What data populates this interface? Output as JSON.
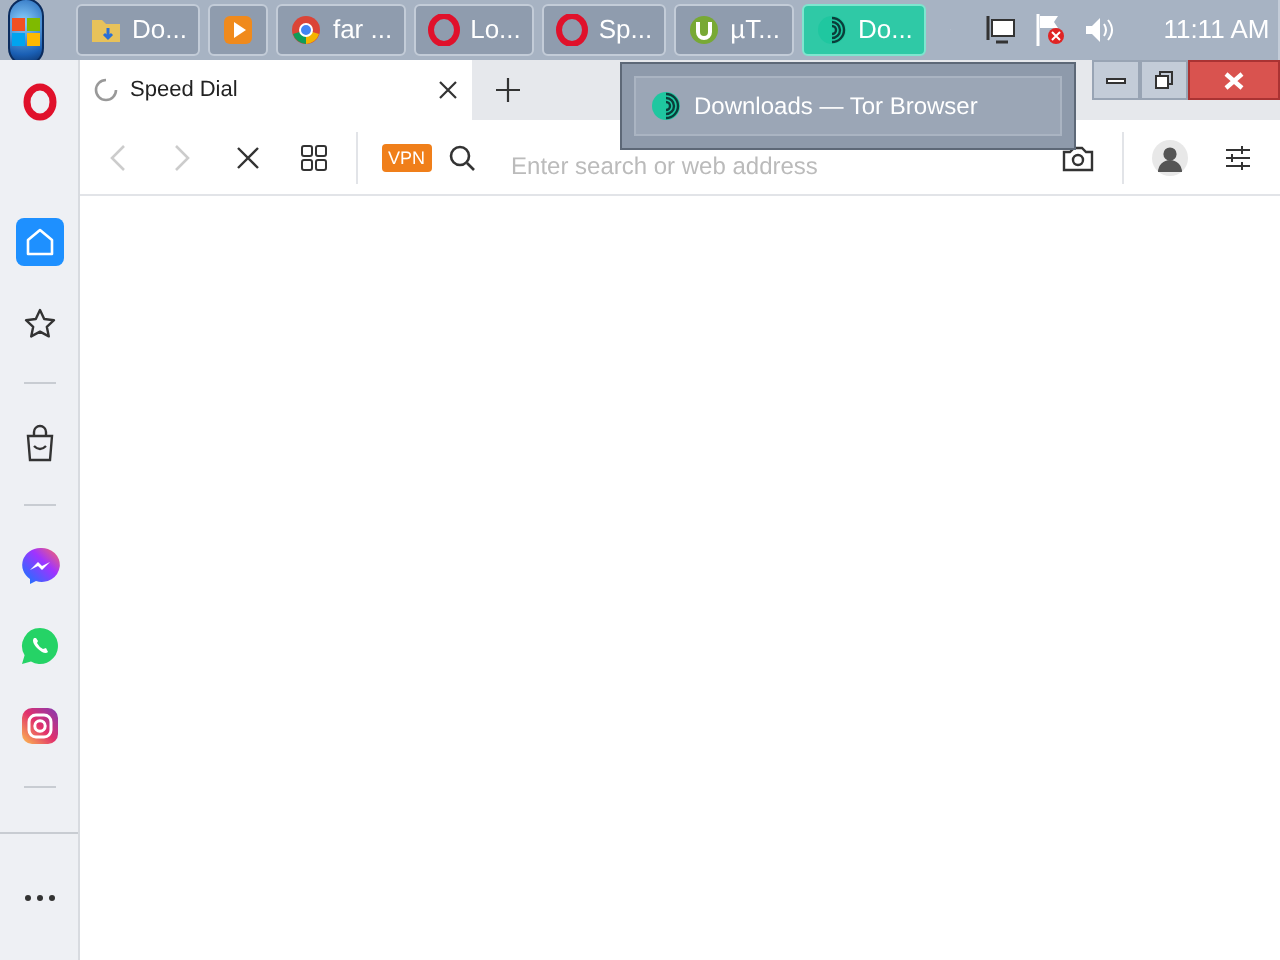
{
  "taskbar": {
    "buttons": [
      {
        "label": "Do...",
        "kind": "folder",
        "selected": false
      },
      {
        "kind": "player",
        "selected": false
      },
      {
        "label": "far ...",
        "kind": "chrome",
        "selected": false
      },
      {
        "label": "Lo...",
        "kind": "opera",
        "selected": false
      },
      {
        "label": "Sp...",
        "kind": "opera",
        "selected": false
      },
      {
        "label": "µT...",
        "kind": "utorrent",
        "selected": false
      },
      {
        "label": "Do...",
        "kind": "tor",
        "selected": true
      }
    ],
    "clock": "11:11 AM"
  },
  "tooltip": {
    "label": "Downloads — Tor Browser"
  },
  "browser": {
    "tabs": [
      {
        "title": "Speed Dial",
        "selected": true
      }
    ],
    "vpn": "VPN",
    "address": {
      "placeholder": "Enter search or web address"
    },
    "sidebar": [
      {
        "kind": "home",
        "selected": true
      },
      {
        "kind": "star",
        "selected": false
      },
      {
        "kind": "divider"
      },
      {
        "kind": "bag",
        "selected": false
      },
      {
        "kind": "divider"
      },
      {
        "kind": "messenger",
        "selected": false
      },
      {
        "kind": "whatsapp",
        "selected": false
      },
      {
        "kind": "instagram",
        "selected": false
      },
      {
        "kind": "divider"
      }
    ]
  }
}
